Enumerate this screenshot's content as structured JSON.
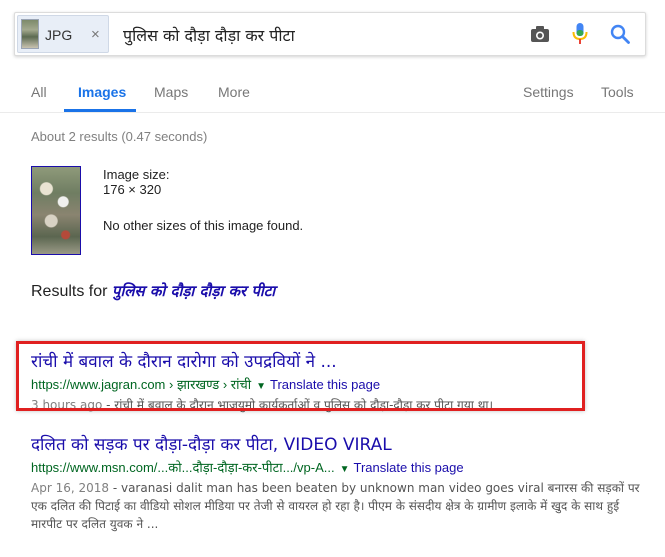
{
  "search": {
    "chip_label": "JPG",
    "chip_close": "×",
    "query": "पुलिस को दौड़ा दौड़ा कर पीटा"
  },
  "tabs": {
    "items": [
      {
        "label": "All"
      },
      {
        "label": "Images"
      },
      {
        "label": "Maps"
      },
      {
        "label": "More"
      },
      {
        "label": "Settings"
      },
      {
        "label": "Tools"
      }
    ],
    "active": "Images"
  },
  "stats": "About 2 results (0.47 seconds)",
  "image_info": {
    "size_label": "Image size:",
    "size_value": "176 × 320",
    "other_sizes": "No other sizes of this image found."
  },
  "results_for": {
    "prefix": "Results for",
    "query": "पुलिस को दौड़ा दौड़ा कर पीटा"
  },
  "results": [
    {
      "title": "रांची में बवाल के दौरान दारोगा को उपद्रवियों ने ...",
      "url": "https://www.jagran.com › झारखण्ड › रांची",
      "translate": "Translate this page",
      "date": "3 hours ago",
      "snippet": " - रांची में बवाल के दौरान भाजयुमो कार्यकर्ताओं व पुलिस को दौड़ा-दौड़ा कर पीटा गया था।"
    },
    {
      "title": "दलित को सड़क पर दौड़ा-दौड़ा कर पीटा, VIDEO VIRAL",
      "url": "https://www.msn.com/...को...दौड़ा-दौड़ा-कर-पीटा.../vp-A...",
      "translate": "Translate this page",
      "date": "Apr 16, 2018",
      "snippet": " - varanasi dalit man has been beaten by unknown man video goes viral बनारस की सड़कों पर एक दलित की पिटाई का वीडियो सोशल मीडिया पर तेजी से वायरल हो रहा है। पीएम के संसदीय क्षेत्र के ग्रामीण इलाके में खुद के साथ हुई मारपीट पर दलित युवक ने ..."
    }
  ],
  "colors": {
    "link": "#1a0dab",
    "url_green": "#006621",
    "accent_blue": "#1a73e8",
    "highlight_red": "#e02020"
  }
}
